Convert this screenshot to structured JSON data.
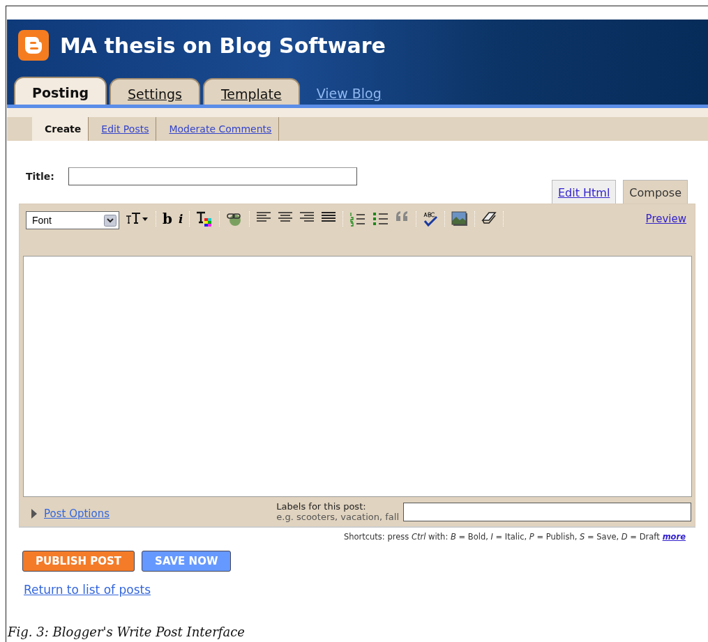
{
  "header": {
    "title": "MA thesis on Blog Software"
  },
  "tabs": [
    {
      "label": "Posting",
      "selected": true
    },
    {
      "label": "Settings",
      "selected": false
    },
    {
      "label": "Template",
      "selected": false
    }
  ],
  "view_blog_link": "View Blog",
  "subtabs": [
    {
      "label": "Create",
      "selected": true
    },
    {
      "label": "Edit Posts",
      "selected": false
    },
    {
      "label": "Moderate Comments",
      "selected": false
    }
  ],
  "title_field": {
    "label": "Title:"
  },
  "editor_modes": [
    {
      "label": "Edit Html",
      "selected": false
    },
    {
      "label": "Compose",
      "selected": true
    }
  ],
  "toolbar": {
    "font_select": "Font",
    "bold": "b",
    "italic": "i",
    "preview": "Preview"
  },
  "post_options": {
    "label": "Post Options",
    "expanded": false
  },
  "labels": {
    "label": "Labels for this post:",
    "hint": "e.g. scooters, vacation, fall"
  },
  "shortcuts": {
    "text": "Shortcuts: press *Ctrl* with: *B* = Bold, *I* = Italic, *P* = Publish, *S* = Save, *D* = Draft",
    "link": "more"
  },
  "buttons": [
    {
      "label": "PUBLISH POST",
      "kind": "primary"
    },
    {
      "label": "SAVE NOW",
      "kind": "secondary"
    }
  ],
  "return_link": "Return to list of posts",
  "caption": "Fig. 3: Blogger's Write Post Interface"
}
